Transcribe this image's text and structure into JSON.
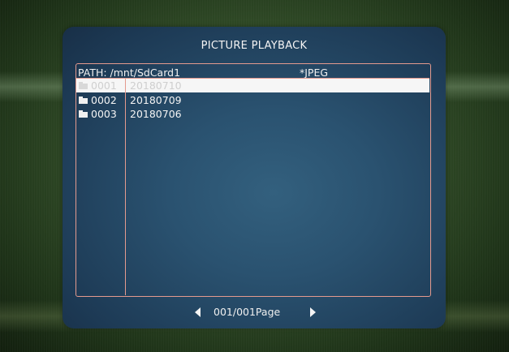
{
  "dialog": {
    "title": "PICTURE PLAYBACK"
  },
  "file_panel": {
    "path": "PATH: /mnt/SdCard1",
    "filter": "*JPEG",
    "rows": [
      {
        "number": "0001",
        "date": "20180710",
        "selected": true
      },
      {
        "number": "0002",
        "date": "20180709",
        "selected": false
      },
      {
        "number": "0003",
        "date": "20180706",
        "selected": false
      }
    ]
  },
  "pager": {
    "label": "001/001Page",
    "prev_icon": "triangle-left-icon",
    "next_icon": "triangle-right-icon"
  },
  "colors": {
    "dialog_bg": "#2a5270",
    "panel_border": "#e49a8e",
    "selection_bg": "#f6f6f6",
    "text": "#f4f4f4"
  }
}
